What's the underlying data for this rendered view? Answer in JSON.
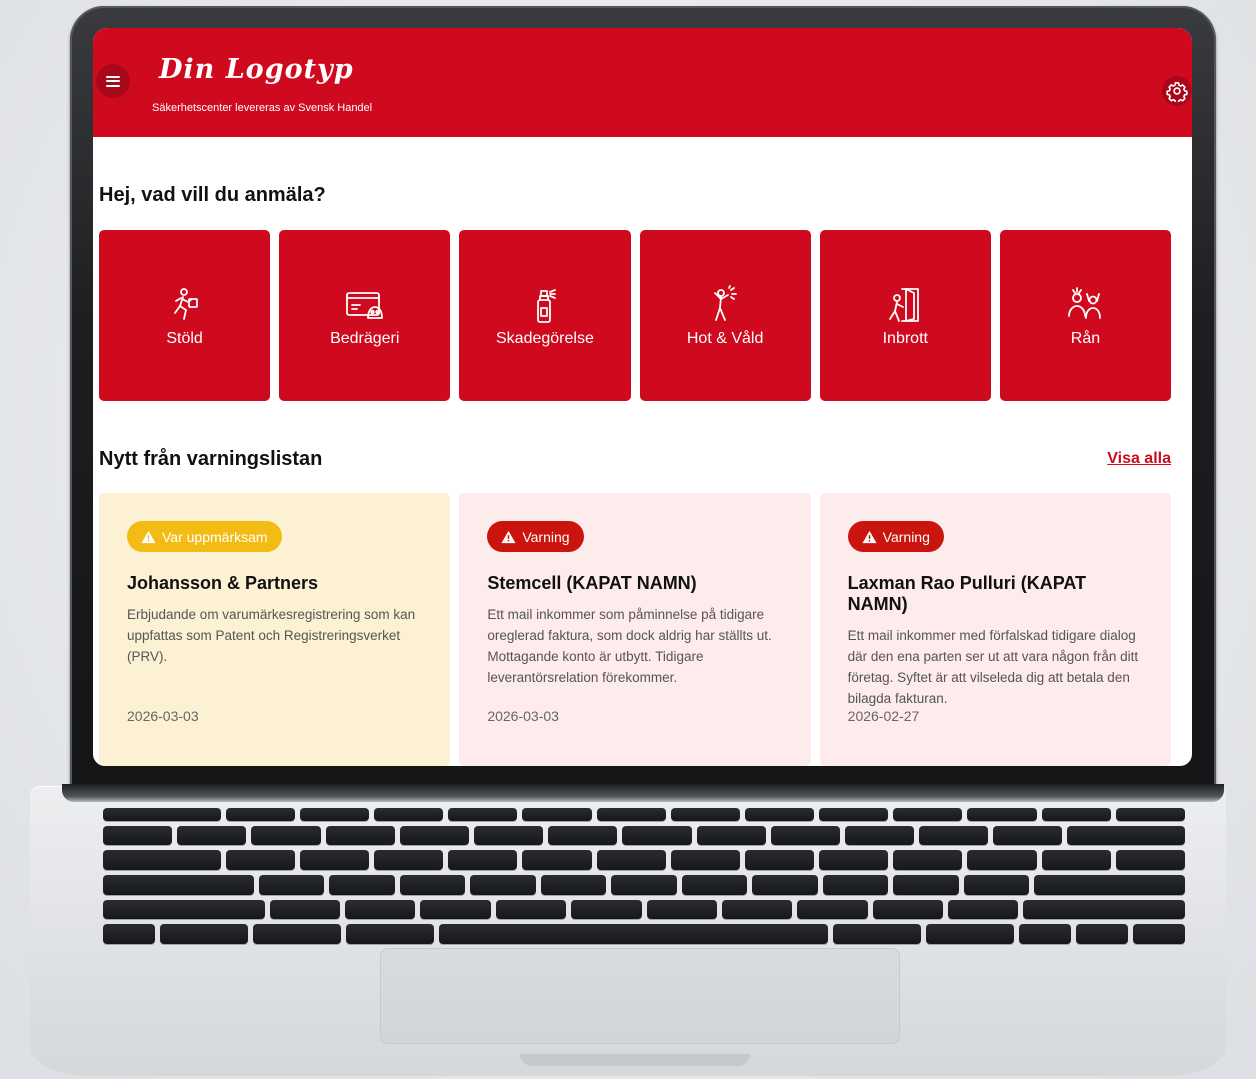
{
  "header": {
    "logo_text": "Din Logotyp",
    "tagline": "Säkerhetscenter levereras av Svensk Handel",
    "brand_color": "#cf0a1f"
  },
  "main": {
    "greeting": "Hej, vad vill du anmäla?",
    "categories": [
      {
        "label": "Stöld",
        "icon": "running-thief-icon"
      },
      {
        "label": "Bedrägeri",
        "icon": "card-skull-icon"
      },
      {
        "label": "Skadegörelse",
        "icon": "spray-can-icon"
      },
      {
        "label": "Hot & Våld",
        "icon": "violence-icon"
      },
      {
        "label": "Inbrott",
        "icon": "door-break-in-icon"
      },
      {
        "label": "Rån",
        "icon": "robbery-icon"
      }
    ],
    "warnings_title": "Nytt från varningslistan",
    "see_all_label": "Visa alla",
    "warnings": [
      {
        "badge": "Var uppmärksam",
        "badge_color": "#f3bc14",
        "title": "Johansson & Partners",
        "text": "Erbjudande om varumärkesregistrering som kan uppfattas som Patent och Registreringsverket (PRV).",
        "date": "2026-03-03"
      },
      {
        "badge": "Varning",
        "badge_color": "#c9150d",
        "title": "Stemcell (KAPAT NAMN)",
        "text": "Ett mail inkommer som påminnelse på tidigare oreglerad faktura, som dock aldrig har ställts ut. Mottagande konto är utbytt. Tidigare leverantörsrelation förekommer.",
        "date": "2026-03-03"
      },
      {
        "badge": "Varning",
        "badge_color": "#c9150d",
        "title": "Laxman Rao Pulluri (KAPAT NAMN)",
        "text": "Ett mail inkommer med förfalskad tidigare dialog där den ena parten ser ut att vara någon från ditt företag. Syftet är att vilseleda dig att betala den bilagda fakturan.",
        "date": "2026-02-27"
      }
    ]
  }
}
